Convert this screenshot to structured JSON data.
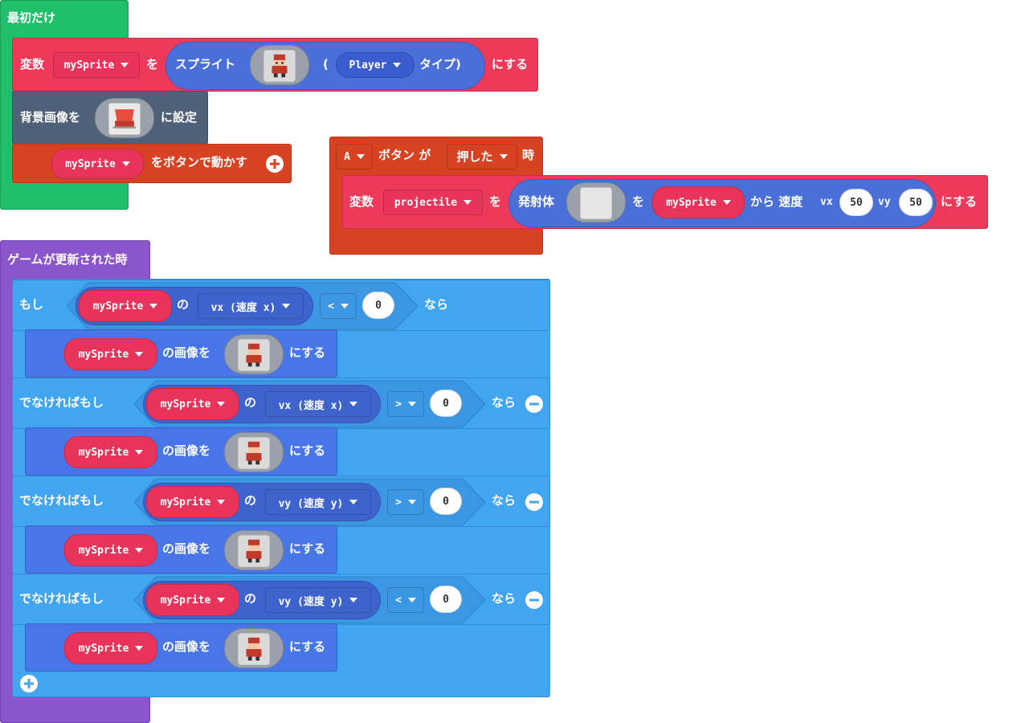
{
  "on_start": {
    "hat_label": "最初だけ",
    "set_var": {
      "prefix": "変数",
      "var": "mySprite",
      "to": "を",
      "sprite_label": "スプライト",
      "paren_open": "(",
      "kind": "Player",
      "type_close": "タイプ)",
      "suffix": "にする"
    },
    "set_bg": {
      "prefix": "背景画像を",
      "suffix": "に設定"
    },
    "move_buttons": {
      "var": "mySprite",
      "suffix": "をボタンで動かす"
    }
  },
  "on_button": {
    "button": "A",
    "mid": "ボタン が",
    "event": "押した",
    "suffix": "時",
    "set_var": {
      "prefix": "変数",
      "var": "projectile",
      "to": "を",
      "create_label": "発射体",
      "wo": "を",
      "from_var": "mySprite",
      "from_label": "から 速度",
      "vx_label": "vx",
      "vx": "50",
      "vy_label": "vy",
      "vy": "50",
      "suffix": "にする"
    }
  },
  "on_update": {
    "hat_label": "ゲームが更新された時",
    "if_label": "もし",
    "elseif_label": "でなければもし",
    "then_label": "なら",
    "of_label": "の",
    "set_image_label": "の画像を",
    "suffix": "にする",
    "conditions": [
      {
        "var": "mySprite",
        "prop": "vx (速度 x)",
        "op": "<",
        "value": "0"
      },
      {
        "var": "mySprite",
        "prop": "vx (速度 x)",
        "op": ">",
        "value": "0"
      },
      {
        "var": "mySprite",
        "prop": "vy (速度 y)",
        "op": ">",
        "value": "0"
      },
      {
        "var": "mySprite",
        "prop": "vy (速度 y)",
        "op": "<",
        "value": "0"
      }
    ],
    "actions": [
      {
        "var": "mySprite"
      },
      {
        "var": "mySprite"
      },
      {
        "var": "mySprite"
      },
      {
        "var": "mySprite"
      }
    ]
  },
  "icons": {
    "add": "plus-circle-icon",
    "remove": "minus-circle-icon",
    "dropdown": "caret-down-icon"
  },
  "colors": {
    "events": "#20bf6b",
    "variables": "#ed3a5a",
    "scene": "#4f6178",
    "controller": "#d74322",
    "game": "#8b55cc",
    "logic": "#42a5f0",
    "sprites": "#4876e8"
  }
}
